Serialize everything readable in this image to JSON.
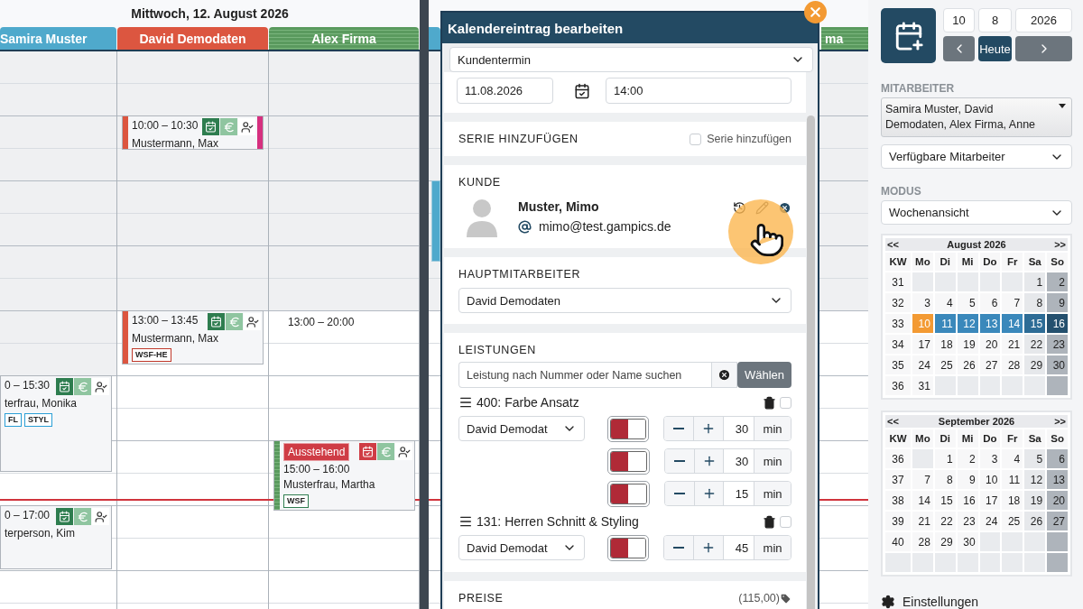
{
  "day_view": {
    "title": "Mittwoch, 12. August 2026",
    "columns": [
      {
        "name": "Samira Muster",
        "color": "#4fa9cc",
        "striped": false,
        "events": [
          {
            "kind": "confirmed",
            "time": "0 – 15:30",
            "customer": "terfrau, Monika",
            "tags": [
              {
                "label": "FL",
                "color": "#2a9fd6"
              },
              {
                "label": "STYL",
                "color": "#2a9fd6"
              }
            ]
          },
          {
            "kind": "confirmed",
            "time": "0 – 17:00",
            "customer": "terperson, Kim"
          }
        ]
      },
      {
        "name": "David Demodaten",
        "color": "#dc5640",
        "striped": false,
        "events": [
          {
            "kind": "confirmed",
            "time": "10:00 – 10:30",
            "customer": "Mustermann, Max",
            "color": "#d6307f"
          },
          {
            "kind": "confirmed",
            "time": "13:00 – 13:45",
            "customer": "Mustermann, Max",
            "tags": [
              {
                "label": "WSF-HE",
                "color": "#c0392b"
              }
            ]
          }
        ]
      },
      {
        "name": "Alex Firma",
        "color": "#5a9a5e",
        "striped": true,
        "hours": "13:00 – 20:00",
        "events": [
          {
            "kind": "pending",
            "badge": "Ausstehend",
            "time": "15:00 – 16:00",
            "customer": "Musterfrau, Martha",
            "tags": [
              {
                "label": "WSF",
                "color": "#2e7d4f"
              }
            ]
          }
        ]
      }
    ]
  },
  "next_day": {
    "column_fragment": "ma"
  },
  "dialog": {
    "title": "Kalendereintrag bearbeiten",
    "type": "Kundentermin",
    "date": "11.08.2026",
    "time": "14:00",
    "series": {
      "heading": "SERIE HINZUFÜGEN",
      "label": "Serie hinzufügen",
      "checked": false
    },
    "customer": {
      "heading": "KUNDE",
      "name": "Muster, Mimo",
      "email": "mimo@test.gampics.de"
    },
    "main_staff": {
      "heading": "HAUPTMITARBEITER",
      "value": "David Demodaten"
    },
    "services": {
      "heading": "LEISTUNGEN",
      "placeholder": "Leistung nach Nummer oder Name suchen",
      "button": "Wählen",
      "items": [
        {
          "title": "400: Farbe Ansatz",
          "checked": false,
          "staff": "David Demodat",
          "steps": [
            {
              "on": true,
              "value": "30",
              "unit": "min"
            },
            {
              "on": true,
              "value": "30",
              "unit": "min"
            },
            {
              "on": true,
              "value": "15",
              "unit": "min"
            }
          ]
        },
        {
          "title": "131: Herren Schnitt & Styling",
          "checked": false,
          "staff": "David Demodat",
          "steps": [
            {
              "on": true,
              "value": "45",
              "unit": "min"
            }
          ]
        }
      ]
    },
    "prices": {
      "heading": "PREISE",
      "total": "(115,00)"
    }
  },
  "sidebar": {
    "date_fields": [
      "10",
      "8",
      "2026"
    ],
    "today_button": "Heute",
    "staff_label": "MITARBEITER",
    "staff_value": "Samira Muster, David Demodaten, Alex Firma, Anne",
    "staff_filter": "Verfügbare Mitarbeiter",
    "mode_label": "MODUS",
    "mode": "Wochenansicht",
    "calendars": [
      {
        "prev": "<<",
        "title": "August 2026",
        "next": ">>",
        "weekdays": [
          "KW",
          "Mo",
          "Di",
          "Mi",
          "Do",
          "Fr",
          "Sa",
          "So"
        ],
        "weeks": [
          {
            "kw": "31",
            "selected": false,
            "days": [
              {
                "d": "1",
                "today": false
              },
              {
                "d": "2",
                "today": false
              }
            ]
          },
          {
            "kw": "32",
            "selected": false,
            "days": [
              {
                "d": "3",
                "today": false
              },
              {
                "d": "4",
                "today": false
              },
              {
                "d": "5",
                "today": false
              },
              {
                "d": "6",
                "today": false
              },
              {
                "d": "7",
                "today": false
              },
              {
                "d": "8",
                "today": false
              },
              {
                "d": "9",
                "today": false
              }
            ]
          },
          {
            "kw": "33",
            "selected": true,
            "days": [
              {
                "d": "10",
                "today": true
              },
              {
                "d": "11",
                "today": false
              },
              {
                "d": "12",
                "today": false
              },
              {
                "d": "13",
                "today": false
              },
              {
                "d": "14",
                "today": false
              },
              {
                "d": "15",
                "today": false
              },
              {
                "d": "16",
                "today": false
              }
            ]
          },
          {
            "kw": "34",
            "selected": false,
            "days": [
              {
                "d": "17",
                "today": false
              },
              {
                "d": "18",
                "today": false
              },
              {
                "d": "19",
                "today": false
              },
              {
                "d": "20",
                "today": false
              },
              {
                "d": "21",
                "today": false
              },
              {
                "d": "22",
                "today": false
              },
              {
                "d": "23",
                "today": false
              }
            ]
          },
          {
            "kw": "35",
            "selected": false,
            "days": [
              {
                "d": "24",
                "today": false
              },
              {
                "d": "25",
                "today": false
              },
              {
                "d": "26",
                "today": false
              },
              {
                "d": "27",
                "today": false
              },
              {
                "d": "28",
                "today": false
              },
              {
                "d": "29",
                "today": false
              },
              {
                "d": "30",
                "today": false
              }
            ]
          },
          {
            "kw": "36",
            "selected": false,
            "days": [
              {
                "d": "31",
                "today": false
              }
            ]
          }
        ]
      },
      {
        "prev": "<<",
        "title": "September 2026",
        "next": ">>",
        "weekdays": [
          "KW",
          "Mo",
          "Di",
          "Mi",
          "Do",
          "Fr",
          "Sa",
          "So"
        ],
        "weeks": [
          {
            "kw": "36",
            "selected": false,
            "days": [
              {
                "d": "1",
                "today": false
              },
              {
                "d": "2",
                "today": false
              },
              {
                "d": "3",
                "today": false
              },
              {
                "d": "4",
                "today": false
              },
              {
                "d": "5",
                "today": false
              },
              {
                "d": "6",
                "today": false
              }
            ]
          },
          {
            "kw": "37",
            "selected": false,
            "days": [
              {
                "d": "7",
                "today": false
              },
              {
                "d": "8",
                "today": false
              },
              {
                "d": "9",
                "today": false
              },
              {
                "d": "10",
                "today": false
              },
              {
                "d": "11",
                "today": false
              },
              {
                "d": "12",
                "today": false
              },
              {
                "d": "13",
                "today": false
              }
            ]
          },
          {
            "kw": "38",
            "selected": false,
            "days": [
              {
                "d": "14",
                "today": false
              },
              {
                "d": "15",
                "today": false
              },
              {
                "d": "16",
                "today": false
              },
              {
                "d": "17",
                "today": false
              },
              {
                "d": "18",
                "today": false
              },
              {
                "d": "19",
                "today": false
              },
              {
                "d": "20",
                "today": false
              }
            ]
          },
          {
            "kw": "39",
            "selected": false,
            "days": [
              {
                "d": "21",
                "today": false
              },
              {
                "d": "22",
                "today": false
              },
              {
                "d": "23",
                "today": false
              },
              {
                "d": "24",
                "today": false
              },
              {
                "d": "25",
                "today": false
              },
              {
                "d": "26",
                "today": false
              },
              {
                "d": "27",
                "today": false
              }
            ]
          },
          {
            "kw": "40",
            "selected": false,
            "days": [
              {
                "d": "28",
                "today": false
              },
              {
                "d": "29",
                "today": false
              },
              {
                "d": "30",
                "today": false
              }
            ]
          }
        ]
      }
    ],
    "settings": "Einstellungen"
  }
}
